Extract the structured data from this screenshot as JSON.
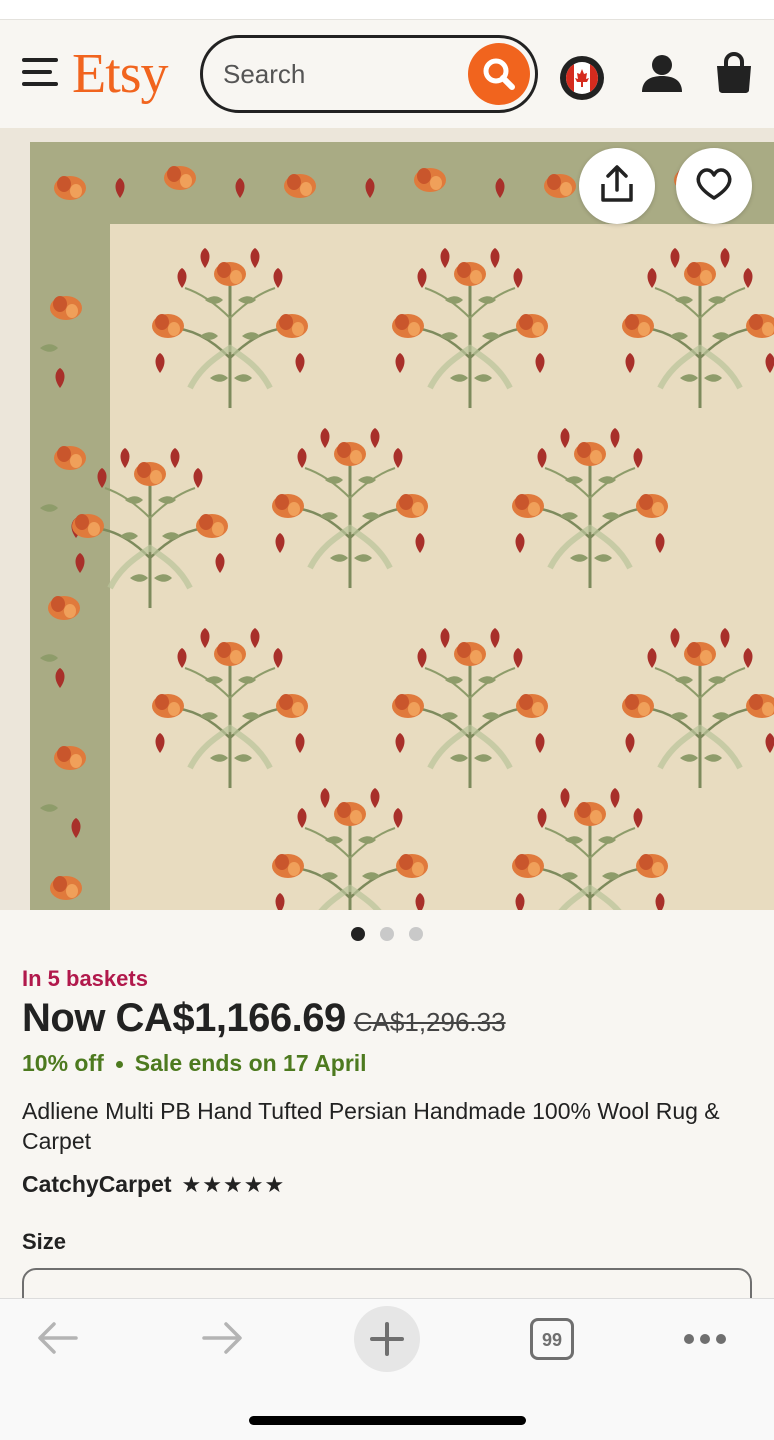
{
  "header": {
    "logo": "Etsy",
    "search_placeholder": "Search"
  },
  "product": {
    "baskets": "In 5 baskets",
    "price_now": "Now CA$1,166.69",
    "price_old": "CA$1,296.33",
    "discount": "10% off",
    "sale_ends": "Sale ends on 17 April",
    "title": "Adliene Multi PB Hand Tufted Persian Handmade 100% Wool Rug & Carpet",
    "shop": "CatchyCarpet",
    "rating_stars": "★★★★★",
    "size_label": "Size"
  },
  "gallery": {
    "image_count": 3,
    "active_index": 0
  },
  "browser": {
    "tab_count": "99"
  },
  "colors": {
    "brand": "#f1641e",
    "basket_text": "#b1194c",
    "sale_text": "#4d7a1f",
    "rug_field": "#e8dcc0",
    "rug_border": "#a9ab84"
  },
  "icons": [
    "menu-icon",
    "search-icon",
    "canada-flag-icon",
    "user-icon",
    "shopping-bag-icon",
    "share-icon",
    "heart-icon",
    "back-arrow-icon",
    "forward-arrow-icon",
    "plus-icon",
    "tabs-icon",
    "more-icon"
  ]
}
